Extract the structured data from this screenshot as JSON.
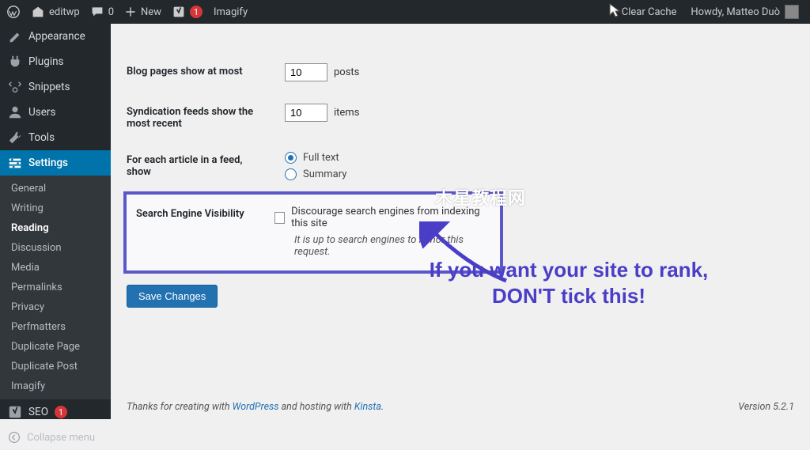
{
  "adminbar": {
    "site_name": "editwp",
    "comments_count": "0",
    "new_label": "New",
    "notif_count": "1",
    "imagify_label": "Imagify",
    "clear_cache": "Clear Cache",
    "howdy": "Howdy, Matteo Duò"
  },
  "sidebar": {
    "items": {
      "appearance": "Appearance",
      "plugins": "Plugins",
      "snippets": "Snippets",
      "users": "Users",
      "tools": "Tools",
      "settings": "Settings",
      "seo": "SEO",
      "seo_count": "1"
    },
    "sub": {
      "general": "General",
      "writing": "Writing",
      "reading": "Reading",
      "discussion": "Discussion",
      "media": "Media",
      "permalinks": "Permalinks",
      "privacy": "Privacy",
      "perfmatters": "Perfmatters",
      "duplicate_page": "Duplicate Page",
      "duplicate_post": "Duplicate Post",
      "imagify": "Imagify"
    },
    "collapse": "Collapse menu"
  },
  "settings": {
    "blog_pages_label": "Blog pages show at most",
    "blog_pages_value": "10",
    "blog_pages_unit": "posts",
    "syndication_label": "Syndication feeds show the most recent",
    "syndication_value": "10",
    "syndication_unit": "items",
    "feed_label": "For each article in a feed, show",
    "feed_full": "Full text",
    "feed_summary": "Summary",
    "sev_label": "Search Engine Visibility",
    "sev_checkbox": "Discourage search engines from indexing this site",
    "sev_note": "It is up to search engines to honor this request.",
    "save": "Save Changes"
  },
  "annotation": "If you want your site to rank, DON'T tick this!",
  "watermark": "木星教程网",
  "footer": {
    "thanks_pre": "Thanks for creating with ",
    "wp": "WordPress",
    "mid": " and hosting with ",
    "kinsta": "Kinsta",
    "version": "Version 5.2.1"
  }
}
